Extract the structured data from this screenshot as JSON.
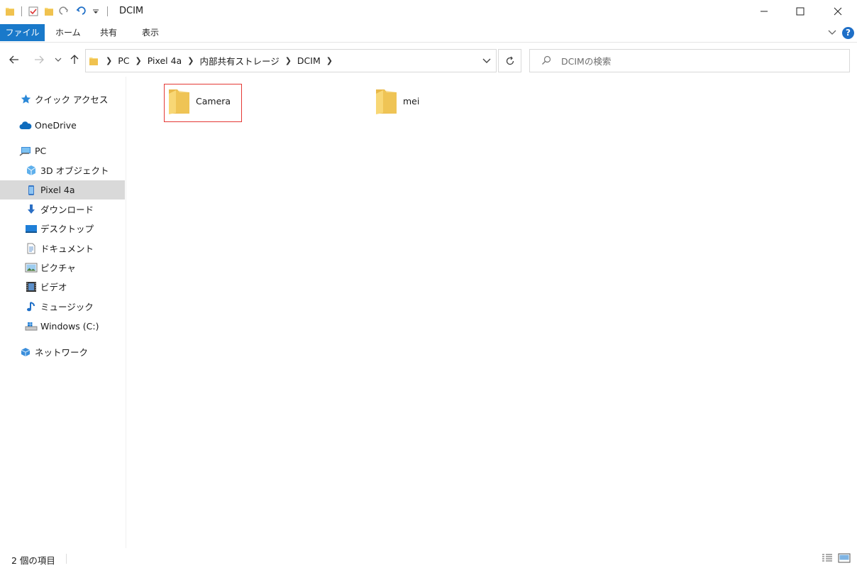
{
  "window": {
    "title": "DCIM",
    "controls": [
      "minimize-icon",
      "maximize-icon",
      "close-icon"
    ]
  },
  "ribbon": {
    "tabs": [
      "ファイル",
      "ホーム",
      "共有",
      "表示"
    ],
    "help": "?"
  },
  "address": {
    "crumbs": [
      "PC",
      "Pixel 4a",
      "内部共有ストレージ",
      "DCIM"
    ],
    "search_placeholder": "DCIMの検索"
  },
  "nav": {
    "items": [
      {
        "label": "クイック アクセス",
        "icon": "star-icon"
      },
      {
        "label": "OneDrive",
        "icon": "cloud-icon"
      },
      {
        "label": "PC",
        "icon": "pc-icon"
      },
      {
        "label": "3D オブジェクト",
        "icon": "cube-icon"
      },
      {
        "label": "Pixel 4a",
        "icon": "phone-icon"
      },
      {
        "label": "ダウンロード",
        "icon": "download-icon"
      },
      {
        "label": "デスクトップ",
        "icon": "desktop-icon"
      },
      {
        "label": "ドキュメント",
        "icon": "document-icon"
      },
      {
        "label": "ピクチャ",
        "icon": "picture-icon"
      },
      {
        "label": "ビデオ",
        "icon": "video-icon"
      },
      {
        "label": "ミュージック",
        "icon": "music-icon"
      },
      {
        "label": "Windows (C:)",
        "icon": "drive-icon"
      },
      {
        "label": "ネットワーク",
        "icon": "network-icon"
      }
    ],
    "selected": "Pixel 4a"
  },
  "content": {
    "folders": [
      {
        "name": "Camera",
        "highlighted": true
      },
      {
        "name": "mei",
        "highlighted": false
      }
    ]
  },
  "status": {
    "item_count": "2 個の項目"
  },
  "colors": {
    "accent": "#1979ca",
    "highlight_border": "#e53935",
    "selected_bg": "#d9d9d9",
    "folder_yellow": "#f8d775"
  }
}
